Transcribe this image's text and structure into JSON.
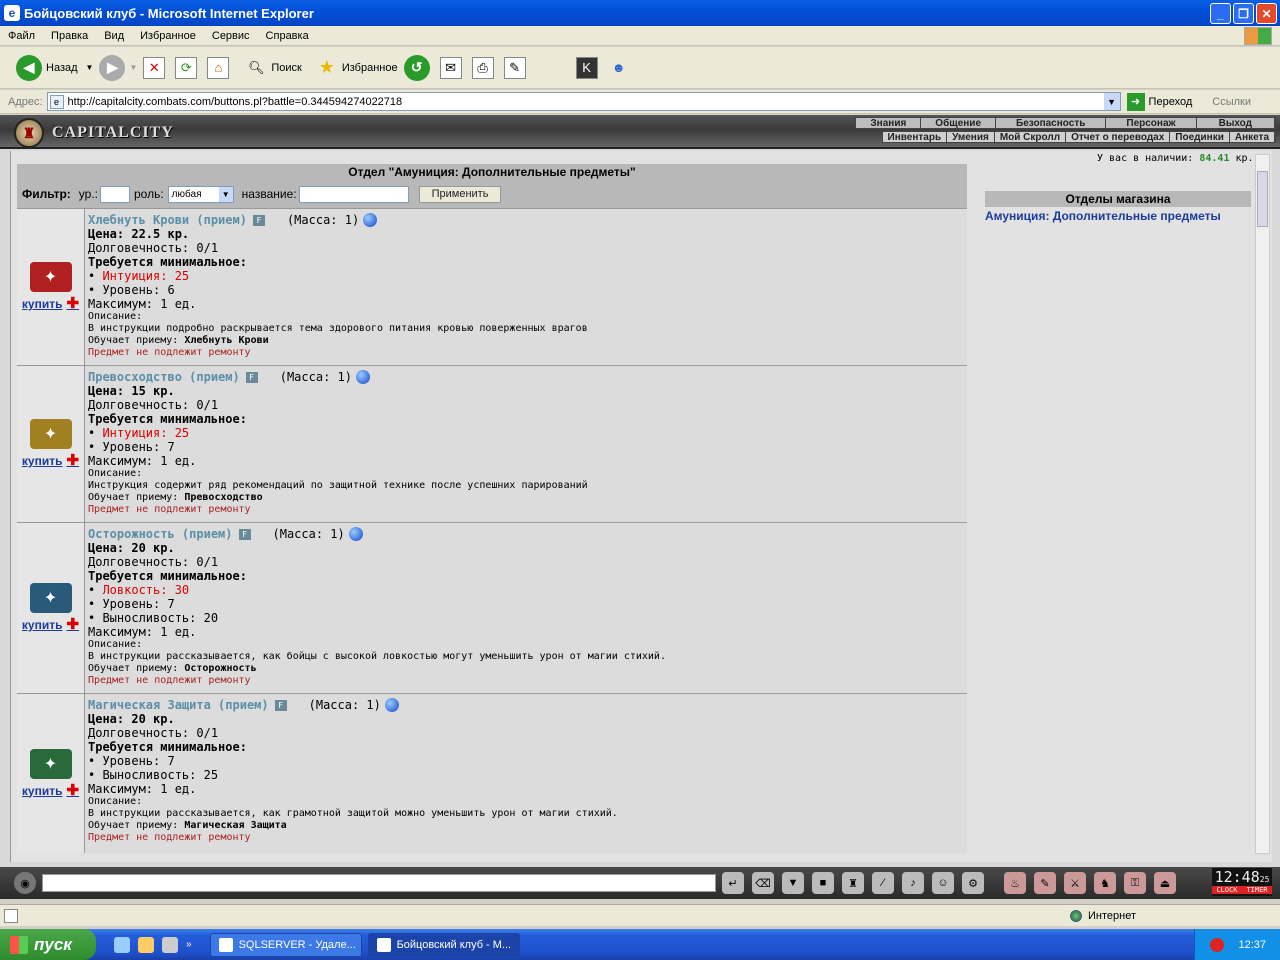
{
  "window": {
    "title": "Бойцовский клуб - Microsoft Internet Explorer"
  },
  "menu": [
    "Файл",
    "Правка",
    "Вид",
    "Избранное",
    "Сервис",
    "Справка"
  ],
  "toolbar": {
    "back": "Назад",
    "search": "Поиск",
    "favorites": "Избранное"
  },
  "address": {
    "label": "Адрес:",
    "url": "http://capitalcity.combats.com/buttons.pl?battle=0.344594274022718",
    "go": "Переход",
    "links": "Ссылки"
  },
  "site": {
    "logo": "CAPITALCITY",
    "topnav": [
      "Знания",
      "Общение",
      "Безопасность",
      "Персонаж",
      "Выход"
    ],
    "subnav": [
      "Инвентарь",
      "Умения",
      "Мой Скролл",
      "Отчет о переводах",
      "Поединки",
      "Анкета"
    ],
    "money_label": "У вас в наличии:",
    "money_value": "84.41",
    "money_unit": "кр."
  },
  "dept_title": "Отдел \"Амуниция: Дополнительные предметы\"",
  "filter": {
    "label": "Фильтр:",
    "level": "ур.:",
    "role": "роль:",
    "role_value": "любая",
    "name": "название:",
    "apply": "Применить"
  },
  "common": {
    "buy": "купить",
    "mass": "(Масса: 1)",
    "durability": "Долговечность: 0/1",
    "req": "Требуется минимальное:",
    "max": "Максимум: 1 ед.",
    "desc_label": "Описание:",
    "teaches": "Обучает приему:",
    "norepair": "Предмет не подлежит ремонту"
  },
  "items": [
    {
      "name": "Хлебнуть Крови (прием)",
      "price": "Цена: 22.5 кр.",
      "req_red": "Интуиция: 25",
      "level": "Уровень: 6",
      "extra": "",
      "desc": "В инструкции подробно раскрывается тема здорового питания кровью поверженных врагов",
      "skill": "Хлебнуть Крови",
      "color": "#b02020"
    },
    {
      "name": "Превосходство (прием)",
      "price": "Цена: 15 кр.",
      "req_red": "Интуиция: 25",
      "level": "Уровень: 7",
      "extra": "",
      "desc": "Инструкция содержит ряд рекомендаций по защитной технике после успешних парирований",
      "skill": "Превосходство",
      "color": "#a08020"
    },
    {
      "name": "Осторожность (прием)",
      "price": "Цена: 20 кр.",
      "req_red": "Ловкость: 30",
      "level": "Уровень: 7",
      "extra": "Выносливость: 20",
      "desc": "В инструкции рассказывается, как бойцы с высокой ловкостью могут уменьшить урон от магии стихий.",
      "skill": "Осторожность",
      "color": "#2a5a7a"
    },
    {
      "name": "Магическая Защита (прием)",
      "price": "Цена: 20 кр.",
      "req_red": "",
      "level": "Уровень: 7",
      "extra": "Выносливость: 25",
      "desc": "В инструкции рассказывается, как грамотной защитой можно уменьшить урон от магии стихий.",
      "skill": "Магическая Защита",
      "color": "#2a6a3a"
    }
  ],
  "shop": {
    "title": "Отделы магазина",
    "link": "Амуниция: Дополнительные предметы"
  },
  "clock": {
    "time": "12:48",
    "sec": "25",
    "l1": "CLOCK",
    "l2": "TIMER"
  },
  "status": {
    "zone": "Интернет"
  },
  "taskbar": {
    "start": "пуск",
    "task1": "SQLSERVER - Удале...",
    "task2": "Бойцовский клуб - M...",
    "time": "12:37"
  }
}
